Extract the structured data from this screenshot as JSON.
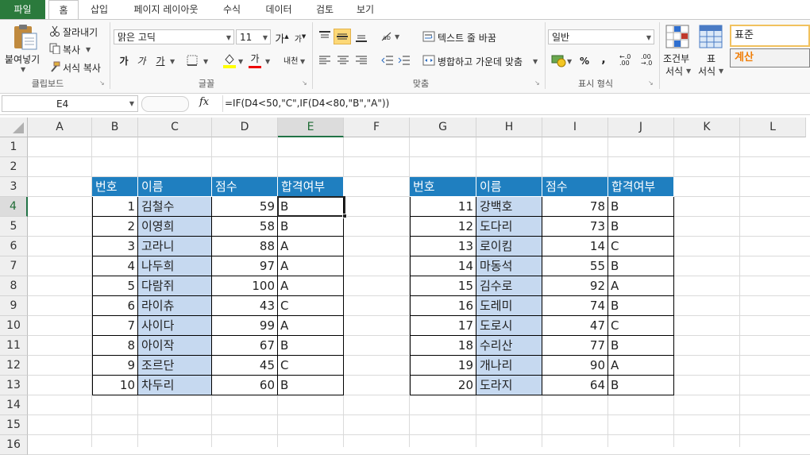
{
  "tabs": {
    "file": "파일",
    "items": [
      "홈",
      "삽입",
      "페이지 레이아웃",
      "수식",
      "데이터",
      "검토",
      "보기"
    ]
  },
  "ribbon": {
    "clipboard": {
      "paste": "붙여넣기",
      "cut": "잘라내기",
      "copy": "복사",
      "format_painter": "서식 복사",
      "group": "클립보드"
    },
    "font": {
      "name": "맑은 고딕",
      "size": "11",
      "grow": "가",
      "shrink": "가",
      "bold": "가",
      "italic": "가",
      "underline": "가",
      "font_color": "가",
      "phonetic": "내천",
      "group": "글꼴"
    },
    "alignment": {
      "wrap_text": "텍스트 줄 바꿈",
      "merge_center": "병합하고 가운데 맞춤",
      "group": "맞춤"
    },
    "number": {
      "format": "일반",
      "percent": "%",
      "comma": ",",
      "increase_decimal": "←.0 .00",
      "decrease_decimal": ".00 →.0",
      "group": "표시 형식"
    },
    "styles": {
      "conditional_line1": "조건부",
      "conditional_line2": "서식",
      "table_line1": "표",
      "table_line2": "서식",
      "style_normal": "표준",
      "style_calc": "계산"
    }
  },
  "formula_bar": {
    "name_box": "E4",
    "fx": "fx",
    "formula": "=IF(D4<50,\"C\",IF(D4<80,\"B\",\"A\"))"
  },
  "columns": [
    "A",
    "B",
    "C",
    "D",
    "E",
    "F",
    "G",
    "H",
    "I",
    "J",
    "K",
    "L"
  ],
  "rows": [
    "1",
    "2",
    "3",
    "4",
    "5",
    "6",
    "7",
    "8",
    "9",
    "10",
    "11",
    "12",
    "13",
    "14",
    "15",
    "16"
  ],
  "table_headers": [
    "번호",
    "이름",
    "점수",
    "합격여부"
  ],
  "table1": [
    [
      "1",
      "김철수",
      "59",
      "B"
    ],
    [
      "2",
      "이영희",
      "58",
      "B"
    ],
    [
      "3",
      "고라니",
      "88",
      "A"
    ],
    [
      "4",
      "나두희",
      "97",
      "A"
    ],
    [
      "5",
      "다람쥐",
      "100",
      "A"
    ],
    [
      "6",
      "라이츄",
      "43",
      "C"
    ],
    [
      "7",
      "사이다",
      "99",
      "A"
    ],
    [
      "8",
      "아이작",
      "67",
      "B"
    ],
    [
      "9",
      "조르단",
      "45",
      "C"
    ],
    [
      "10",
      "차두리",
      "60",
      "B"
    ]
  ],
  "table2": [
    [
      "11",
      "강백호",
      "78",
      "B"
    ],
    [
      "12",
      "도다리",
      "73",
      "B"
    ],
    [
      "13",
      "로이킴",
      "14",
      "C"
    ],
    [
      "14",
      "마동석",
      "55",
      "B"
    ],
    [
      "15",
      "김수로",
      "92",
      "A"
    ],
    [
      "16",
      "도레미",
      "74",
      "B"
    ],
    [
      "17",
      "도로시",
      "47",
      "C"
    ],
    [
      "18",
      "수리산",
      "77",
      "B"
    ],
    [
      "19",
      "개나리",
      "90",
      "A"
    ],
    [
      "20",
      "도라지",
      "64",
      "B"
    ]
  ],
  "colors": {
    "file_tab": "#2b7a3c",
    "table_header": "#1f7fc0",
    "name_fill": "#c6d9f0",
    "calc_style": "#f07f09"
  }
}
